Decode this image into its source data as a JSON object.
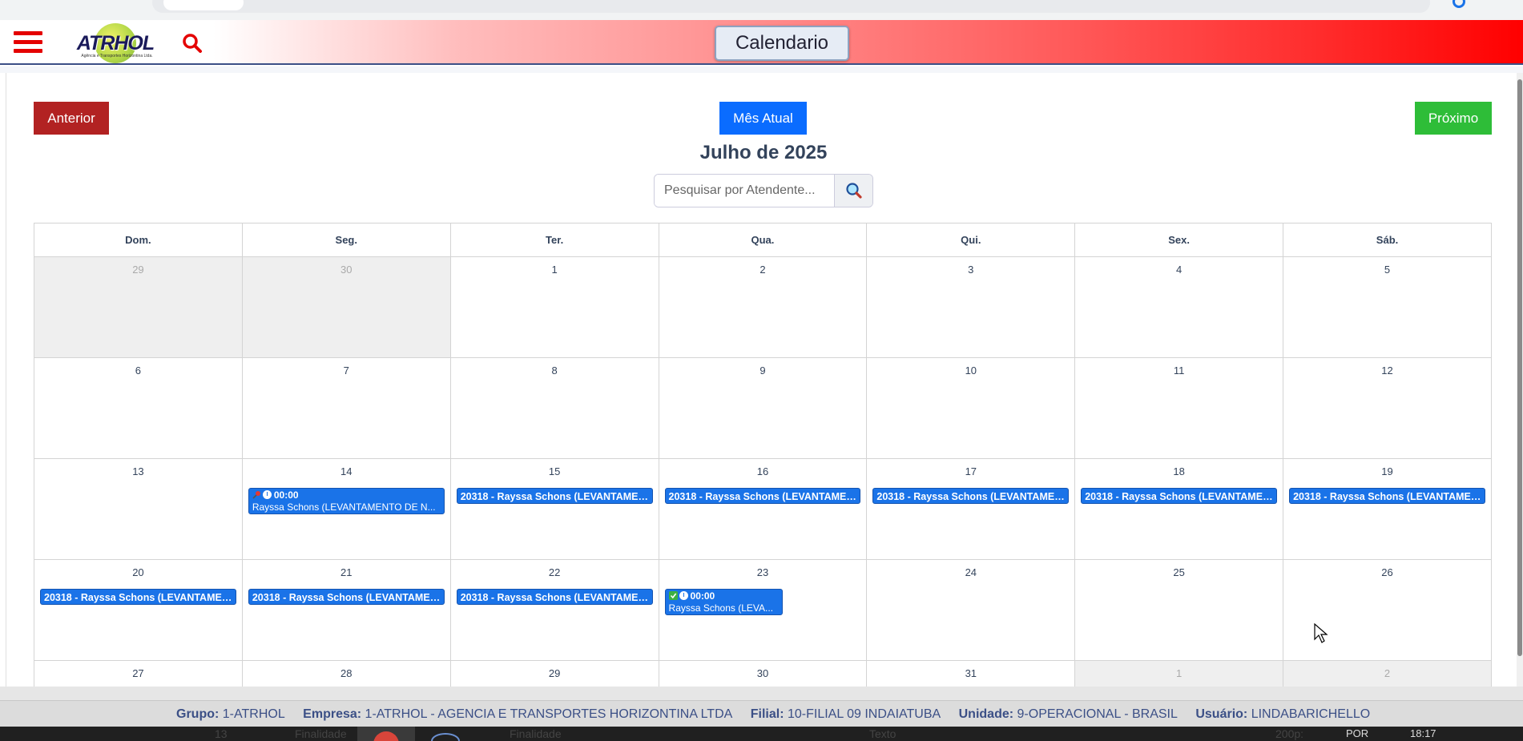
{
  "header": {
    "title": "Calendario",
    "logo_text": "ATRHOL",
    "logo_tagline": "Agência e Transportes Horizontina Ltda."
  },
  "nav": {
    "prev_label": "Anterior",
    "today_label": "Mês Atual",
    "next_label": "Próximo"
  },
  "month_title": "Julho de 2025",
  "search": {
    "placeholder": "Pesquisar por Atendente..."
  },
  "weekdays": [
    "Dom.",
    "Seg.",
    "Ter.",
    "Qua.",
    "Qui.",
    "Sex.",
    "Sáb."
  ],
  "weeks": [
    [
      "29",
      "30",
      "1",
      "2",
      "3",
      "4",
      "5"
    ],
    [
      "6",
      "7",
      "8",
      "9",
      "10",
      "11",
      "12"
    ],
    [
      "13",
      "14",
      "15",
      "16",
      "17",
      "18",
      "19"
    ],
    [
      "20",
      "21",
      "22",
      "23",
      "24",
      "25",
      "26"
    ],
    [
      "27",
      "28",
      "29",
      "30",
      "31",
      "1",
      "2"
    ]
  ],
  "events": {
    "single_label": "20318 - Rayssa Schons (LEVANTAMENT...",
    "jul14": {
      "time": "00:00",
      "text": "Rayssa Schons (LEVANTAMENTO DE N..."
    },
    "jul23": {
      "time": "00:00",
      "text": "Rayssa Schons (LEVA..."
    }
  },
  "footer": {
    "grupo_label": "Grupo:",
    "grupo": "1-ATRHOL",
    "empresa_label": "Empresa:",
    "empresa": "1-ATRHOL - AGENCIA E TRANSPORTES HORIZONTINA LTDA",
    "filial_label": "Filial:",
    "filial": "10-FILIAL 09 INDAIATUBA",
    "unidade_label": "Unidade:",
    "unidade": "9-OPERACIONAL - BRASIL",
    "usuario_label": "Usuário:",
    "usuario": "LINDABARICHELLO"
  },
  "taskbar": {
    "items": [
      "13",
      "Finalidade",
      "Finalidade",
      "Texto",
      "200p:",
      "POR",
      "18:17"
    ]
  },
  "colors": {
    "prev": "#b22222",
    "today": "#0a6cff",
    "next": "#2ebd38",
    "event": "#1a73e8",
    "header_red": "#ff0000"
  },
  "icons": [
    "menu-icon",
    "search-icon",
    "pin-icon",
    "clock-icon",
    "check-icon"
  ]
}
